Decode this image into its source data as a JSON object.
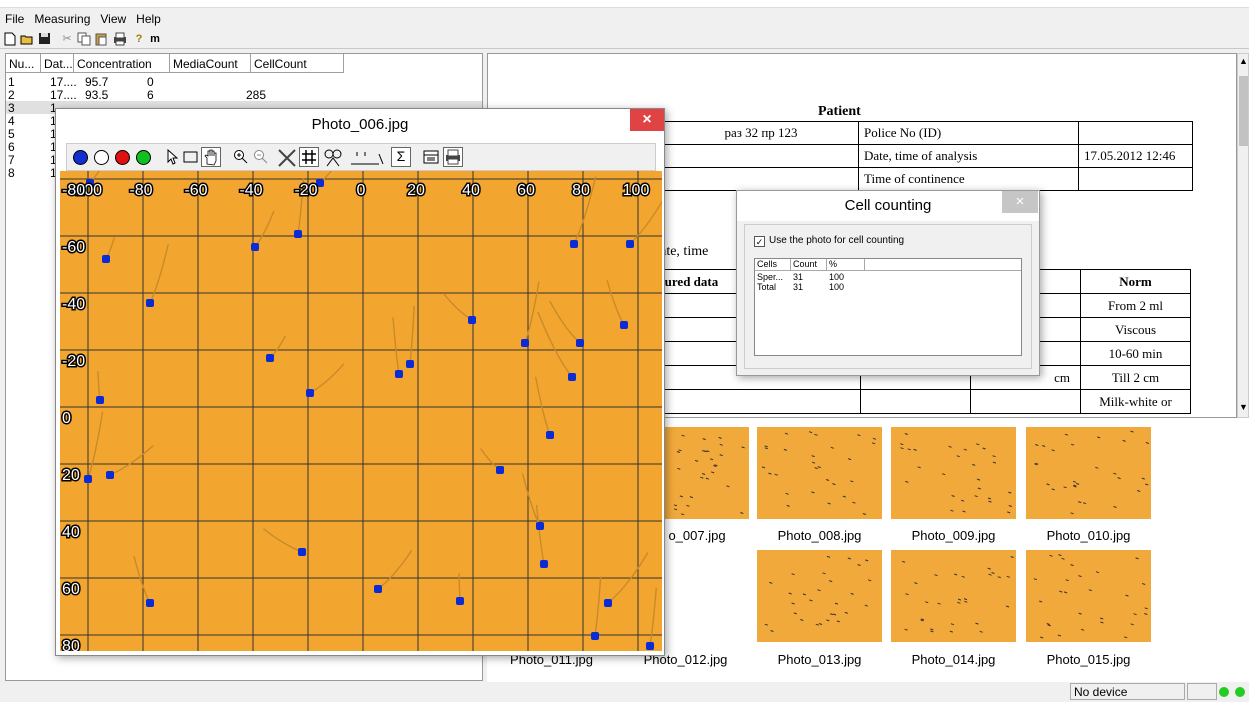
{
  "menu": [
    "File",
    "Measuring",
    "View",
    "Help"
  ],
  "toolbar": {
    "m_label": "m"
  },
  "list": {
    "headers": [
      "Nu...",
      "Dat...",
      "Concentration",
      "MediaCount",
      "CellCount"
    ],
    "rows": [
      {
        "num": "1",
        "date": "17....",
        "conc": "95.7",
        "media": "0",
        "cells": ""
      },
      {
        "num": "2",
        "date": "17....",
        "conc": "93.5",
        "media": "6",
        "cells": "285"
      },
      {
        "num": "3",
        "date": "1",
        "conc": "",
        "media": "",
        "cells": ""
      },
      {
        "num": "4",
        "date": "1",
        "conc": "",
        "media": "",
        "cells": ""
      },
      {
        "num": "5",
        "date": "1",
        "conc": "",
        "media": "",
        "cells": ""
      },
      {
        "num": "6",
        "date": "1",
        "conc": "",
        "media": "",
        "cells": ""
      },
      {
        "num": "7",
        "date": "1",
        "conc": "",
        "media": "",
        "cells": ""
      },
      {
        "num": "8",
        "date": "1",
        "conc": "",
        "media": "",
        "cells": ""
      }
    ]
  },
  "report": {
    "patient_title": "Patient",
    "patient_name": "раз 32 пр 123",
    "police_label": "Police No (ID)",
    "police_value": "",
    "date_label": "Date, time of analysis",
    "date_value": "17.05.2012 12:46",
    "continence_label": "Time of continence",
    "date_time_partial": "Date, time",
    "measured_partial": "isured data",
    "norm_header": "Norm",
    "norms": [
      "From 2 ml",
      "Viscous",
      "10-60 min",
      "Till 2 cm",
      "Milk-white or"
    ],
    "unit_cm": "cm"
  },
  "photo_window": {
    "title": "Photo_006.jpg",
    "close": "×",
    "sigma": "Σ",
    "x_ticks": [
      "-100",
      "-80",
      "-60",
      "-40",
      "-20",
      "0",
      "20",
      "40",
      "60",
      "80",
      "100"
    ],
    "y_ticks": [
      "-80",
      "-60",
      "-40",
      "-20",
      "0",
      "20",
      "40",
      "60",
      "80"
    ]
  },
  "cell_window": {
    "title": "Cell counting",
    "close": "×",
    "checkbox_label": "Use the photo for cell counting",
    "checkbox_mark": "✓",
    "headers": [
      "Cells",
      "Count",
      "%"
    ],
    "rows": [
      {
        "name": "Sper...",
        "count": "31",
        "pct": "100"
      },
      {
        "name": "Total",
        "count": "31",
        "pct": "100"
      }
    ]
  },
  "thumbnails": {
    "row1": [
      "o_007.jpg",
      "Photo_008.jpg",
      "Photo_009.jpg",
      "Photo_010.jpg"
    ],
    "row2": [
      "Photo_011.jpg",
      "Photo_012.jpg",
      "Photo_013.jpg",
      "Photo_014.jpg",
      "Photo_015.jpg"
    ]
  },
  "status": {
    "device": "No device"
  },
  "colors": {
    "photo_bg": "#f3a62f",
    "marker": "#0b2bd6",
    "close": "#e04343",
    "led": "#22cc22"
  }
}
